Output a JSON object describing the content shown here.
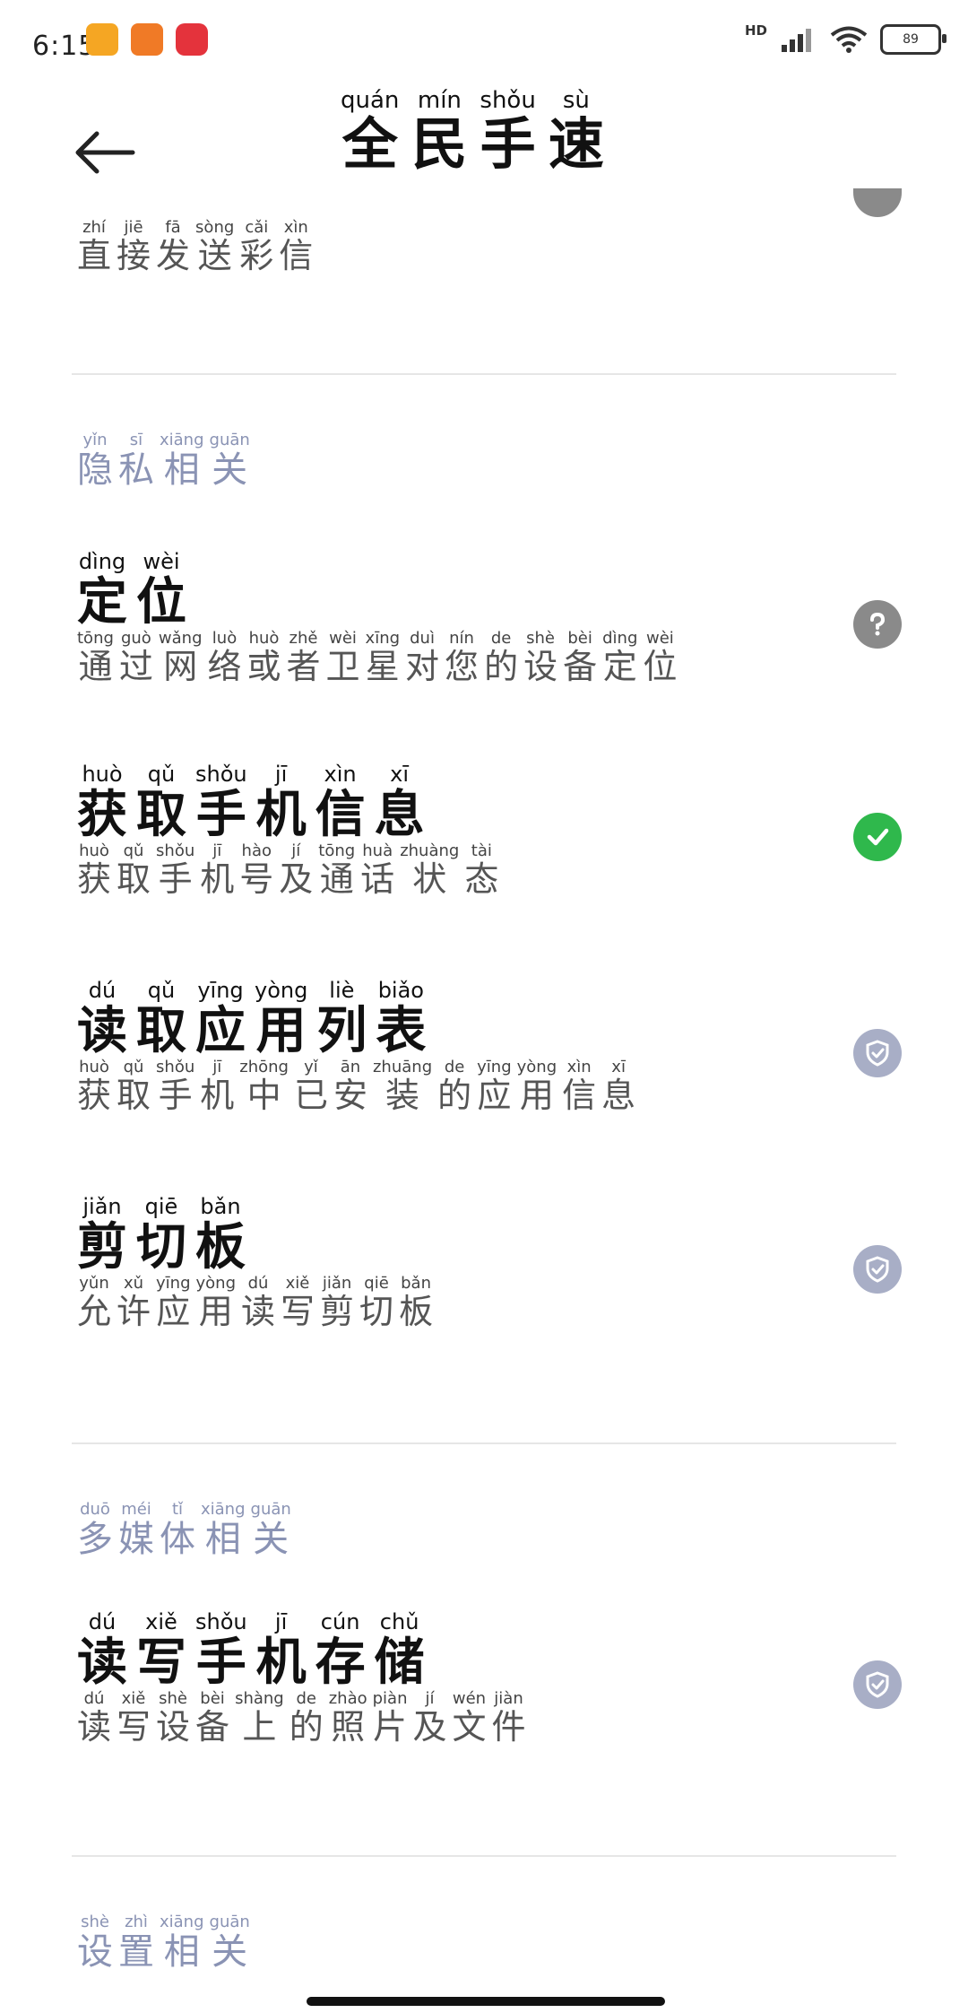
{
  "status_bar": {
    "time": "6:15",
    "network_label": "HD",
    "battery": "89"
  },
  "header": {
    "title": [
      {
        "char": "全",
        "py": "quán"
      },
      {
        "char": "民",
        "py": "mín"
      },
      {
        "char": "手",
        "py": "shǒu"
      },
      {
        "char": "速",
        "py": "sù"
      }
    ]
  },
  "partial_item": {
    "desc": [
      {
        "char": "直",
        "py": "zhí"
      },
      {
        "char": "接",
        "py": "jiē"
      },
      {
        "char": "发",
        "py": "fā"
      },
      {
        "char": "送",
        "py": "sòng"
      },
      {
        "char": "彩",
        "py": "cǎi"
      },
      {
        "char": "信",
        "py": "xìn"
      }
    ]
  },
  "sections": [
    {
      "title": [
        {
          "char": "隐",
          "py": "yǐn"
        },
        {
          "char": "私",
          "py": "sī"
        },
        {
          "char": "相",
          "py": "xiāng"
        },
        {
          "char": "关",
          "py": "guān"
        }
      ],
      "items": [
        {
          "title": [
            {
              "char": "定",
              "py": "dìng"
            },
            {
              "char": "位",
              "py": "wèi"
            }
          ],
          "desc": [
            {
              "char": "通",
              "py": "tōng"
            },
            {
              "char": "过",
              "py": "guò"
            },
            {
              "char": "网",
              "py": "wǎng"
            },
            {
              "char": "络",
              "py": "luò"
            },
            {
              "char": "或",
              "py": "huò"
            },
            {
              "char": "者",
              "py": "zhě"
            },
            {
              "char": "卫",
              "py": "wèi"
            },
            {
              "char": "星",
              "py": "xīng"
            },
            {
              "char": "对",
              "py": "duì"
            },
            {
              "char": "您",
              "py": "nín"
            },
            {
              "char": "的",
              "py": "de"
            },
            {
              "char": "设",
              "py": "shè"
            },
            {
              "char": "备",
              "py": "bèi"
            },
            {
              "char": "定",
              "py": "dìng"
            },
            {
              "char": "位",
              "py": "wèi"
            }
          ],
          "status": "question"
        },
        {
          "title": [
            {
              "char": "获",
              "py": "huò"
            },
            {
              "char": "取",
              "py": "qǔ"
            },
            {
              "char": "手",
              "py": "shǒu"
            },
            {
              "char": "机",
              "py": "jī"
            },
            {
              "char": "信",
              "py": "xìn"
            },
            {
              "char": "息",
              "py": "xī"
            }
          ],
          "desc": [
            {
              "char": "获",
              "py": "huò"
            },
            {
              "char": "取",
              "py": "qǔ"
            },
            {
              "char": "手",
              "py": "shǒu"
            },
            {
              "char": "机",
              "py": "jī"
            },
            {
              "char": "号",
              "py": "hào"
            },
            {
              "char": "及",
              "py": "jí"
            },
            {
              "char": "通",
              "py": "tōng"
            },
            {
              "char": "话",
              "py": "huà"
            },
            {
              "char": "状",
              "py": "zhuàng"
            },
            {
              "char": "态",
              "py": "tài"
            }
          ],
          "status": "granted"
        },
        {
          "title": [
            {
              "char": "读",
              "py": "dú"
            },
            {
              "char": "取",
              "py": "qǔ"
            },
            {
              "char": "应",
              "py": "yīng"
            },
            {
              "char": "用",
              "py": "yòng"
            },
            {
              "char": "列",
              "py": "liè"
            },
            {
              "char": "表",
              "py": "biǎo"
            }
          ],
          "desc": [
            {
              "char": "获",
              "py": "huò"
            },
            {
              "char": "取",
              "py": "qǔ"
            },
            {
              "char": "手",
              "py": "shǒu"
            },
            {
              "char": "机",
              "py": "jī"
            },
            {
              "char": "中",
              "py": "zhōng"
            },
            {
              "char": "已",
              "py": "yǐ"
            },
            {
              "char": "安",
              "py": "ān"
            },
            {
              "char": "装",
              "py": "zhuāng"
            },
            {
              "char": "的",
              "py": "de"
            },
            {
              "char": "应",
              "py": "yīng"
            },
            {
              "char": "用",
              "py": "yòng"
            },
            {
              "char": "信",
              "py": "xìn"
            },
            {
              "char": "息",
              "py": "xī"
            }
          ],
          "status": "shield"
        },
        {
          "title": [
            {
              "char": "剪",
              "py": "jiǎn"
            },
            {
              "char": "切",
              "py": "qiē"
            },
            {
              "char": "板",
              "py": "bǎn"
            }
          ],
          "desc": [
            {
              "char": "允",
              "py": "yǔn"
            },
            {
              "char": "许",
              "py": "xǔ"
            },
            {
              "char": "应",
              "py": "yīng"
            },
            {
              "char": "用",
              "py": "yòng"
            },
            {
              "char": "读",
              "py": "dú"
            },
            {
              "char": "写",
              "py": "xiě"
            },
            {
              "char": "剪",
              "py": "jiǎn"
            },
            {
              "char": "切",
              "py": "qiē"
            },
            {
              "char": "板",
              "py": "bǎn"
            }
          ],
          "status": "shield"
        }
      ]
    },
    {
      "title": [
        {
          "char": "多",
          "py": "duō"
        },
        {
          "char": "媒",
          "py": "méi"
        },
        {
          "char": "体",
          "py": "tǐ"
        },
        {
          "char": "相",
          "py": "xiāng"
        },
        {
          "char": "关",
          "py": "guān"
        }
      ],
      "items": [
        {
          "title": [
            {
              "char": "读",
              "py": "dú"
            },
            {
              "char": "写",
              "py": "xiě"
            },
            {
              "char": "手",
              "py": "shǒu"
            },
            {
              "char": "机",
              "py": "jī"
            },
            {
              "char": "存",
              "py": "cún"
            },
            {
              "char": "储",
              "py": "chǔ"
            }
          ],
          "desc": [
            {
              "char": "读",
              "py": "dú"
            },
            {
              "char": "写",
              "py": "xiě"
            },
            {
              "char": "设",
              "py": "shè"
            },
            {
              "char": "备",
              "py": "bèi"
            },
            {
              "char": "上",
              "py": "shàng"
            },
            {
              "char": "的",
              "py": "de"
            },
            {
              "char": "照",
              "py": "zhào"
            },
            {
              "char": "片",
              "py": "piàn"
            },
            {
              "char": "及",
              "py": "jí"
            },
            {
              "char": "文",
              "py": "wén"
            },
            {
              "char": "件",
              "py": "jiàn"
            }
          ],
          "status": "shield"
        }
      ]
    },
    {
      "title": [
        {
          "char": "设",
          "py": "shè"
        },
        {
          "char": "置",
          "py": "zhì"
        },
        {
          "char": "相",
          "py": "xiāng"
        },
        {
          "char": "关",
          "py": "guān"
        }
      ],
      "items": []
    }
  ]
}
